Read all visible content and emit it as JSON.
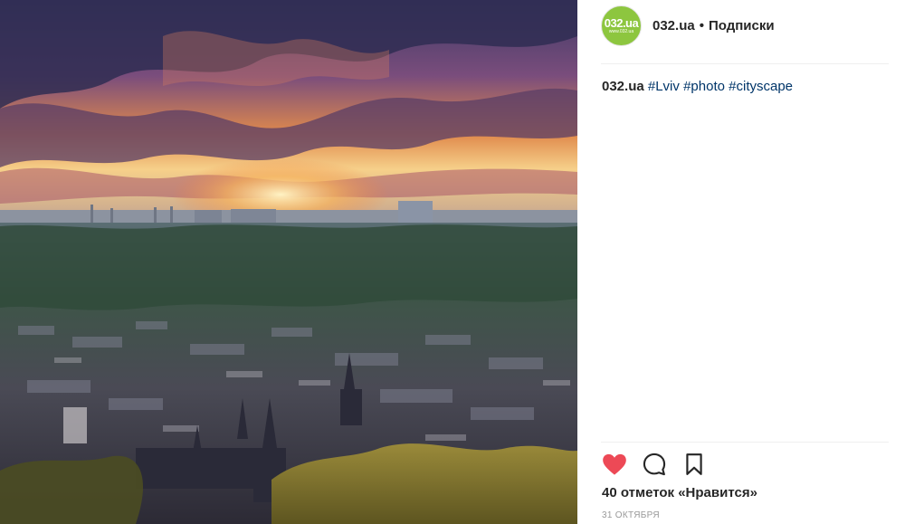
{
  "post": {
    "photo_alt": "",
    "account": {
      "avatar_line1": "032.ua",
      "avatar_line2": "www.032.ua",
      "username": "032.ua",
      "separator": "•",
      "follow_label": "Подписки"
    },
    "caption": {
      "username": "032.ua",
      "hashtags": [
        "#Lviv",
        "#photo",
        "#cityscape"
      ]
    },
    "actions": {
      "like_icon": "heart-icon",
      "comment_icon": "comment-icon",
      "save_icon": "bookmark-icon",
      "liked": true,
      "like_color": "#ed4956"
    },
    "likes_text": "40 отметок «Нравится»",
    "date_text": "31 ОКТЯБРЯ"
  }
}
